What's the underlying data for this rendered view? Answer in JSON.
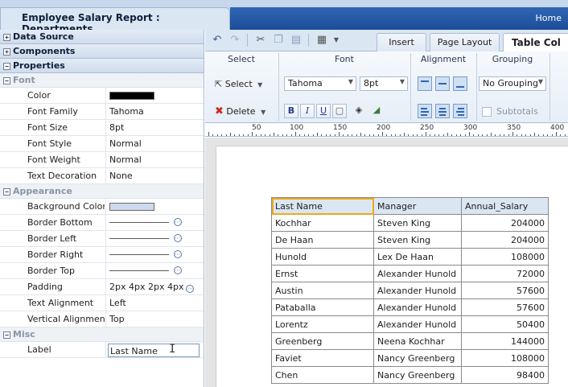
{
  "window": {
    "title": "Employee Salary Report : Departments",
    "home_link": "Home"
  },
  "left_panel": {
    "sections": {
      "data_source": "Data Source",
      "components": "Components",
      "properties": "Properties"
    },
    "groups": {
      "font": "Font",
      "appearance": "Appearance",
      "misc": "Misc"
    },
    "font_props": {
      "color_label": "Color",
      "color_value": "#000000",
      "family_label": "Font Family",
      "family_value": "Tahoma",
      "size_label": "Font Size",
      "size_value": "8pt",
      "style_label": "Font Style",
      "style_value": "Normal",
      "weight_label": "Font Weight",
      "weight_value": "Normal",
      "decoration_label": "Text Decoration",
      "decoration_value": "None"
    },
    "appearance_props": {
      "bg_label": "Background Color",
      "bg_value": "#cdd9ec",
      "border_bottom_label": "Border Bottom",
      "border_left_label": "Border Left",
      "border_right_label": "Border Right",
      "border_top_label": "Border Top",
      "padding_label": "Padding",
      "padding_value": "2px 4px 2px 4px",
      "text_align_label": "Text Alignment",
      "text_align_value": "Left",
      "vertical_align_label": "Vertical Alignment",
      "vertical_align_value": "Top"
    },
    "misc_props": {
      "label_label": "Label",
      "label_value": "Last Name"
    }
  },
  "ribbon": {
    "tabs": [
      "Insert",
      "Page Layout",
      "Table Col"
    ],
    "groups": {
      "select": "Select",
      "font": "Font",
      "alignment": "Alignment",
      "grouping": "Grouping"
    },
    "select_label": "Select",
    "delete_label": "Delete",
    "font_family": "Tahoma",
    "font_size": "8pt",
    "bold": "B",
    "italic": "I",
    "underline": "U",
    "grouping_value": "No Grouping",
    "subtotals_label": "Subtotals"
  },
  "ruler": {
    "labels": [
      "50",
      "100",
      "150",
      "200",
      "250",
      "300",
      "350",
      "400"
    ]
  },
  "table": {
    "headers": [
      "Last Name",
      "Manager",
      "Annual_Salary"
    ],
    "rows": [
      [
        "Kochhar",
        "Steven King",
        "204000"
      ],
      [
        "De Haan",
        "Steven King",
        "204000"
      ],
      [
        "Hunold",
        "Lex De Haan",
        "108000"
      ],
      [
        "Ernst",
        "Alexander Hunold",
        "72000"
      ],
      [
        "Austin",
        "Alexander Hunold",
        "57600"
      ],
      [
        "Pataballa",
        "Alexander Hunold",
        "57600"
      ],
      [
        "Lorentz",
        "Alexander Hunold",
        "50400"
      ],
      [
        "Greenberg",
        "Neena Kochhar",
        "144000"
      ],
      [
        "Faviet",
        "Nancy Greenberg",
        "108000"
      ],
      [
        "Chen",
        "Nancy Greenberg",
        "98400"
      ]
    ]
  }
}
